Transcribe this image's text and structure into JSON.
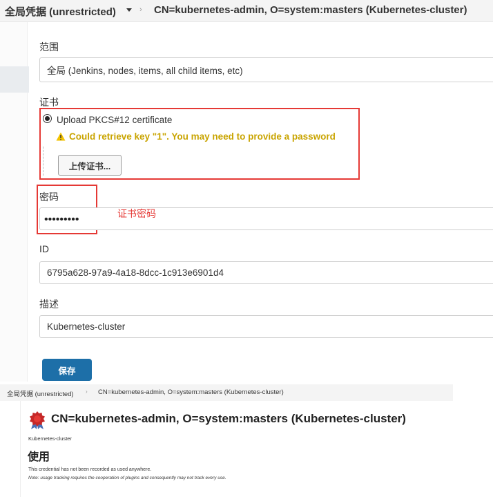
{
  "breadcrumb": {
    "store": "全局凭据 (unrestricted)",
    "credential": "CN=kubernetes-admin, O=system:masters (Kubernetes-cluster)"
  },
  "form": {
    "scope": {
      "label": "范围",
      "value": "全局 (Jenkins, nodes, items, all child items, etc)"
    },
    "certificate": {
      "label": "证书",
      "option_label": "Upload PKCS#12 certificate",
      "warning": "Could retrieve key \"1\". You may need to provide a password",
      "upload_button": "上传证书..."
    },
    "password": {
      "label": "密码",
      "value": "•••••••••",
      "annotation": "证书密码"
    },
    "id": {
      "label": "ID",
      "value": "6795a628-97a9-4a18-8dcc-1c913e6901d4"
    },
    "description": {
      "label": "描述",
      "value": "Kubernetes-cluster"
    },
    "save_button": "保存"
  },
  "snapshot": {
    "breadcrumb_store": "全局凭据 (unrestricted)",
    "breadcrumb_credential": "CN=kubernetes-admin, O=system:masters (Kubernetes-cluster)",
    "title": "CN=kubernetes-admin, O=system:masters (Kubernetes-cluster)",
    "description": "Kubernetes-cluster",
    "usage_heading": "使用",
    "usage_text": "This credential has not been recorded as used anywhere.",
    "usage_note": "Note: usage tracking requires the cooperation of plugins and consequently may not track every use."
  },
  "colors": {
    "accent": "#1d6fa8",
    "warning": "#c9a400",
    "annotation": "#e53935"
  },
  "icons": {
    "breadcrumb_caret": "caret-down-icon",
    "separator": "chevron-right-icon",
    "warning": "warning-icon",
    "seal": "certificate-seal-icon"
  }
}
